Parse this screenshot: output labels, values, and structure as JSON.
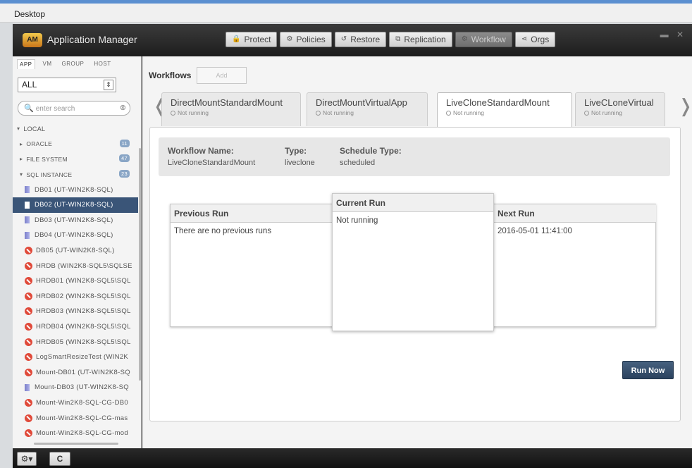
{
  "desktop": {
    "label": "Desktop"
  },
  "app": {
    "title": "Application Manager",
    "logo_text": "AM"
  },
  "nav": [
    {
      "icon": "lock-icon",
      "glyph": "🔒",
      "label": "Protect"
    },
    {
      "icon": "gear-icon",
      "glyph": "⚙",
      "label": "Policies"
    },
    {
      "icon": "restore-icon",
      "glyph": "↺",
      "label": "Restore"
    },
    {
      "icon": "replication-icon",
      "glyph": "⧉",
      "label": "Replication"
    },
    {
      "icon": "workflow-icon",
      "glyph": "⚙",
      "label": "Workflow",
      "active": true
    },
    {
      "icon": "share-icon",
      "glyph": "⋖",
      "label": "Orgs"
    }
  ],
  "window_controls": "▬ ✕",
  "sidebar": {
    "tabs": [
      "APP",
      "VM",
      "GROUP",
      "HOST"
    ],
    "select_value": "ALL",
    "search_placeholder": "enter search",
    "tree": [
      {
        "level": 0,
        "label": "LOCAL",
        "twisty": "▾"
      },
      {
        "level": 1,
        "label": "ORACLE",
        "twisty": "▸",
        "count": "11"
      },
      {
        "level": 1,
        "label": "FILE SYSTEM",
        "twisty": "▸",
        "count": "47"
      },
      {
        "level": 1,
        "label": "SQL INSTANCE",
        "twisty": "▾",
        "count": "23"
      },
      {
        "level": 2,
        "icon": "db",
        "label": "DB01 (UT-WIN2K8-SQL)"
      },
      {
        "level": 2,
        "icon": "db",
        "label": "DB02 (UT-WIN2K8-SQL)",
        "selected": true
      },
      {
        "level": 2,
        "icon": "db",
        "label": "DB03 (UT-WIN2K8-SQL)"
      },
      {
        "level": 2,
        "icon": "db",
        "label": "DB04 (UT-WIN2K8-SQL)"
      },
      {
        "level": 2,
        "icon": "err",
        "label": "DB05 (UT-WIN2K8-SQL)"
      },
      {
        "level": 2,
        "icon": "err",
        "label": "HRDB (WIN2K8-SQL5\\SQLSE"
      },
      {
        "level": 2,
        "icon": "err",
        "label": "HRDB01 (WIN2K8-SQL5\\SQL"
      },
      {
        "level": 2,
        "icon": "err",
        "label": "HRDB02 (WIN2K8-SQL5\\SQL"
      },
      {
        "level": 2,
        "icon": "err",
        "label": "HRDB03 (WIN2K8-SQL5\\SQL"
      },
      {
        "level": 2,
        "icon": "err",
        "label": "HRDB04 (WIN2K8-SQL5\\SQL"
      },
      {
        "level": 2,
        "icon": "err",
        "label": "HRDB05 (WIN2K8-SQL5\\SQL"
      },
      {
        "level": 2,
        "icon": "err",
        "label": "LogSmartResizeTest (WIN2K"
      },
      {
        "level": 2,
        "icon": "err",
        "label": "Mount-DB01 (UT-WIN2K8-SQ"
      },
      {
        "level": 2,
        "icon": "db",
        "label": "Mount-DB03 (UT-WIN2K8-SQ"
      },
      {
        "level": 2,
        "icon": "err",
        "label": "Mount-Win2K8-SQL-CG-DB0"
      },
      {
        "level": 2,
        "icon": "err",
        "label": "Mount-Win2K8-SQL-CG-mas"
      },
      {
        "level": 2,
        "icon": "err",
        "label": "Mount-Win2K8-SQL-CG-mod"
      }
    ]
  },
  "main": {
    "workflows_label": "Workflows",
    "add_label": "Add",
    "prev_chevron": "❬",
    "next_chevron": "❭",
    "tabs": [
      {
        "name": "DirectMountStandardMount",
        "status": "Not running"
      },
      {
        "name": "DirectMountVirtualApp",
        "status": "Not running"
      },
      {
        "name": "LiveCloneStandardMount",
        "status": "Not running",
        "active": true
      },
      {
        "name": "LiveCLoneVirtual",
        "status": "Not running"
      }
    ],
    "info": {
      "name_label": "Workflow Name:",
      "name_value": "LiveCloneStandardMount",
      "type_label": "Type:",
      "type_value": "liveclone",
      "schedule_label": "Schedule Type:",
      "schedule_value": "scheduled"
    },
    "runs": {
      "previous_label": "Previous Run",
      "previous_value": "There are no previous runs",
      "current_label": "Current Run",
      "current_value": "Not running",
      "next_label": "Next Run",
      "next_value": "2016-05-01 11:41:00"
    },
    "run_now_label": "Run Now"
  },
  "bottom": {
    "settings_glyph": "⚙▾",
    "refresh_glyph": "C"
  }
}
